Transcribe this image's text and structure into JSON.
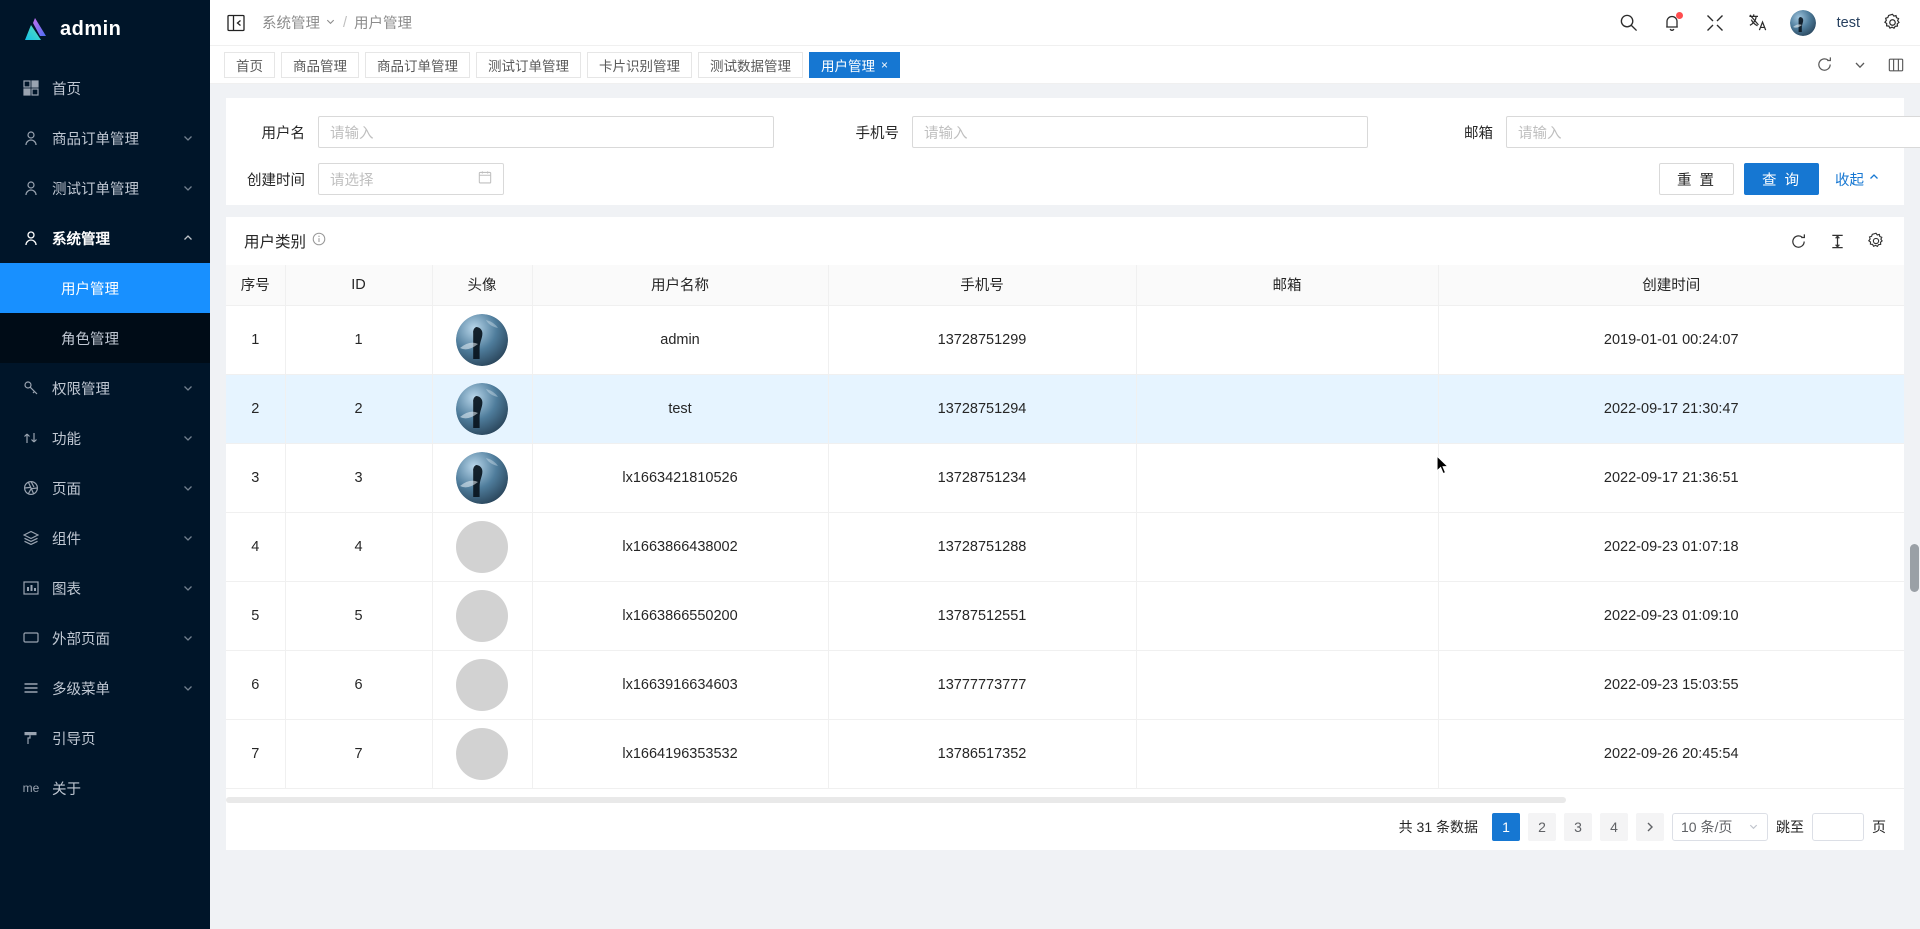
{
  "app": {
    "logo_text": "admin",
    "brand_color": "#1677d2",
    "sidebar_bg": "#001529",
    "active_menu_bg": "#1890ff",
    "row_highlight": "#e6f4ff"
  },
  "sidebar": {
    "items": [
      {
        "label": "首页",
        "icon": "grid-icon",
        "expandable": false,
        "state": ""
      },
      {
        "label": "商品订单管理",
        "icon": "user-icon",
        "expandable": true,
        "state": ""
      },
      {
        "label": "测试订单管理",
        "icon": "user-icon",
        "expandable": true,
        "state": ""
      },
      {
        "label": "系统管理",
        "icon": "user-icon",
        "expandable": true,
        "state": "open"
      },
      {
        "label": "权限管理",
        "icon": "key-icon",
        "expandable": true,
        "state": ""
      },
      {
        "label": "功能",
        "icon": "shuffle-icon",
        "expandable": true,
        "state": ""
      },
      {
        "label": "页面",
        "icon": "aperture-icon",
        "expandable": true,
        "state": ""
      },
      {
        "label": "组件",
        "icon": "layers-icon",
        "expandable": true,
        "state": ""
      },
      {
        "label": "图表",
        "icon": "bar-chart-icon",
        "expandable": true,
        "state": ""
      },
      {
        "label": "外部页面",
        "icon": "monitor-icon",
        "expandable": true,
        "state": ""
      },
      {
        "label": "多级菜单",
        "icon": "menu-lines-icon",
        "expandable": true,
        "state": ""
      },
      {
        "label": "引导页",
        "icon": "guide-icon",
        "expandable": false,
        "state": ""
      },
      {
        "label": "关于",
        "icon": "me-text-icon",
        "expandable": false,
        "state": "",
        "icon_text": "me"
      }
    ],
    "submenu": [
      {
        "label": "用户管理",
        "active": true
      },
      {
        "label": "角色管理",
        "active": false
      }
    ]
  },
  "header": {
    "collapse_icon": "menu-fold-icon",
    "breadcrumb": {
      "parent": "系统管理",
      "separator": "/",
      "current": "用户管理"
    },
    "icons": [
      "search-icon",
      "bell-icon",
      "fullscreen-icon",
      "translate-icon"
    ],
    "user_name": "test",
    "settings_icon": "gear-icon",
    "has_notification_dot": true
  },
  "tabs": {
    "items": [
      {
        "label": "首页",
        "active": false,
        "closable": false
      },
      {
        "label": "商品管理",
        "active": false,
        "closable": false
      },
      {
        "label": "商品订单管理",
        "active": false,
        "closable": false
      },
      {
        "label": "测试订单管理",
        "active": false,
        "closable": false
      },
      {
        "label": "卡片识别管理",
        "active": false,
        "closable": false
      },
      {
        "label": "测试数据管理",
        "active": false,
        "closable": false
      },
      {
        "label": "用户管理",
        "active": true,
        "closable": true,
        "close_glyph": "×"
      }
    ],
    "right_icons": [
      "refresh-icon",
      "chevron-down-icon",
      "columns-icon"
    ]
  },
  "search_form": {
    "fields": [
      {
        "label": "用户名",
        "placeholder": "请输入",
        "value": "",
        "type": "text"
      },
      {
        "label": "手机号",
        "placeholder": "请输入",
        "value": "",
        "type": "text"
      },
      {
        "label": "邮箱",
        "placeholder": "请输入",
        "value": "",
        "type": "text"
      },
      {
        "label": "创建时间",
        "placeholder": "请选择",
        "value": "",
        "type": "date"
      }
    ],
    "reset_label": "重 置",
    "query_label": "查 询",
    "collapse_label": "收起"
  },
  "table_card": {
    "title": "用户类别",
    "info_icon": "info-circle-icon",
    "tools": [
      "refresh-icon",
      "density-icon",
      "settings-gear-icon"
    ]
  },
  "table": {
    "columns": [
      "序号",
      "ID",
      "头像",
      "用户名称",
      "手机号",
      "邮箱",
      "创建时间"
    ],
    "rows": [
      {
        "index": "1",
        "id": "1",
        "avatar": "photo",
        "name": "admin",
        "phone": "13728751299",
        "email": "",
        "created": "2019-01-01 00:24:07",
        "highlight": false
      },
      {
        "index": "2",
        "id": "2",
        "avatar": "photo",
        "name": "test",
        "phone": "13728751294",
        "email": "",
        "created": "2022-09-17 21:30:47",
        "highlight": true
      },
      {
        "index": "3",
        "id": "3",
        "avatar": "photo",
        "name": "lx1663421810526",
        "phone": "13728751234",
        "email": "",
        "created": "2022-09-17 21:36:51",
        "highlight": false
      },
      {
        "index": "4",
        "id": "4",
        "avatar": "blank",
        "name": "lx1663866438002",
        "phone": "13728751288",
        "email": "",
        "created": "2022-09-23 01:07:18",
        "highlight": false
      },
      {
        "index": "5",
        "id": "5",
        "avatar": "blank",
        "name": "lx1663866550200",
        "phone": "13787512551",
        "email": "",
        "created": "2022-09-23 01:09:10",
        "highlight": false
      },
      {
        "index": "6",
        "id": "6",
        "avatar": "blank",
        "name": "lx1663916634603",
        "phone": "13777773777",
        "email": "",
        "created": "2022-09-23 15:03:55",
        "highlight": false
      },
      {
        "index": "7",
        "id": "7",
        "avatar": "blank",
        "name": "lx1664196353532",
        "phone": "13786517352",
        "email": "",
        "created": "2022-09-26 20:45:54",
        "highlight": false
      }
    ]
  },
  "pagination": {
    "total_label": "共 31 条数据",
    "pages": [
      "1",
      "2",
      "3",
      "4"
    ],
    "current_page": "1",
    "next_glyph": "›",
    "page_size_label": "10 条/页",
    "jump_prefix": "跳至",
    "jump_value": "",
    "jump_suffix": "页"
  }
}
